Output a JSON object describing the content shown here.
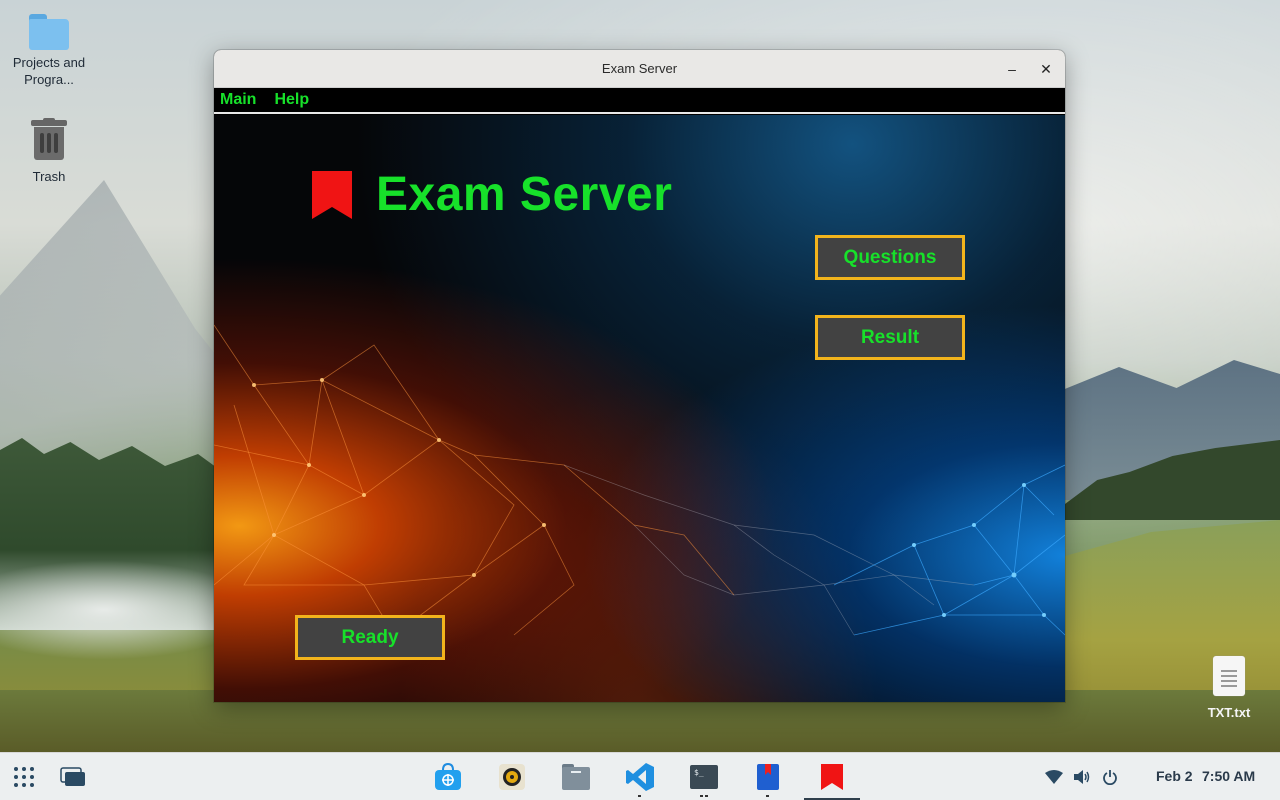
{
  "desktop": {
    "icons": [
      {
        "label": "Projects and Progra..."
      },
      {
        "label": "Trash"
      },
      {
        "label": "TXT.txt"
      }
    ]
  },
  "window": {
    "title": "Exam Server",
    "minimize_symbol": "–",
    "close_symbol": "✕",
    "menu": [
      {
        "label": "Main"
      },
      {
        "label": "Help"
      }
    ],
    "app_title": "Exam Server",
    "buttons": {
      "questions": "Questions",
      "result": "Result",
      "ready": "Ready"
    },
    "accent_text_color": "#17e12a",
    "button_border_color": "#f2b41c",
    "logo_color": "#f01414"
  },
  "taskbar": {
    "apps": [
      "app-grid-icon",
      "window-switcher-icon",
      "software-store-icon",
      "music-player-icon",
      "file-manager-icon",
      "vscode-icon",
      "terminal-icon",
      "bookmark-app-icon",
      "exam-server-icon"
    ],
    "tray": [
      "wifi-icon",
      "volume-icon",
      "power-icon"
    ],
    "date": "Feb 2",
    "time": "7:50 AM"
  }
}
